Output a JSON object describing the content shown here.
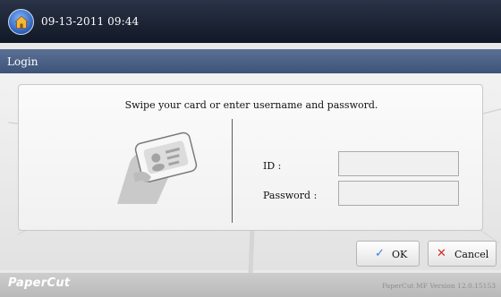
{
  "header": {
    "home_icon": "home-icon",
    "datetime": "09-13-2011 09:44"
  },
  "titlebar": {
    "title": "Login"
  },
  "login": {
    "instruction": "Swipe your card or enter username and password.",
    "card_icon": "card-swipe-icon",
    "id_label": "ID :",
    "id_value": "",
    "password_label": "Password :",
    "password_value": ""
  },
  "buttons": {
    "ok_label": "OK",
    "ok_icon": "checkmark-icon",
    "cancel_label": "Cancel",
    "cancel_icon": "x-icon"
  },
  "footer": {
    "brand": "PaperCut",
    "version": "PaperCut MF Version 12.0.15153"
  },
  "colors": {
    "topbar": "#1a2232",
    "titlebar": "#4a6086",
    "ok_check": "#3b7fd6",
    "cancel_x": "#d12a2a"
  }
}
